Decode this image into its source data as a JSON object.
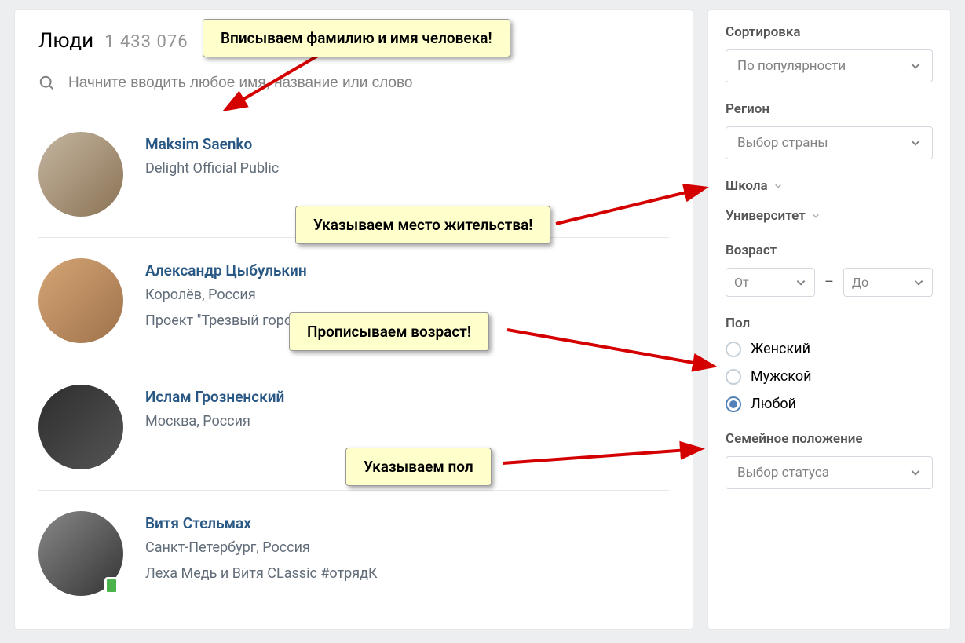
{
  "header": {
    "title": "Люди",
    "count": "1 433 076"
  },
  "search": {
    "placeholder": "Начните вводить любое имя, название или слово"
  },
  "results": [
    {
      "name": "Maksim Saenko",
      "sub1": "Delight Official Public",
      "sub2": "",
      "online": false,
      "avatar_class": "a1"
    },
    {
      "name": "Александр Цыбулькин",
      "sub1": "Королёв, Россия",
      "sub2": "Проект \"Трезвый город\" – Королёв",
      "online": false,
      "avatar_class": "a2"
    },
    {
      "name": "Ислам Грозненский",
      "sub1": "Москва, Россия",
      "sub2": "",
      "online": false,
      "avatar_class": "a3"
    },
    {
      "name": "Витя Стельмах",
      "sub1": "Санкт-Петербург, Россия",
      "sub2": "Леха Медь и Витя CLassic #отрядК",
      "online": true,
      "avatar_class": "a4"
    }
  ],
  "filters": {
    "sort_label": "Сортировка",
    "sort_value": "По популярности",
    "region_label": "Регион",
    "region_value": "Выбор страны",
    "school_label": "Школа",
    "university_label": "Университет",
    "age_label": "Возраст",
    "age_from": "От",
    "age_to": "До",
    "age_dash": "–",
    "gender_label": "Пол",
    "gender_options": {
      "female": "Женский",
      "male": "Мужской",
      "any": "Любой"
    },
    "status_label": "Семейное положение",
    "status_value": "Выбор статуса"
  },
  "callouts": {
    "c1": "Вписываем фамилию и имя человека!",
    "c2": "Указываем место жительства!",
    "c3": "Прописываем возраст!",
    "c4": "Указываем пол"
  }
}
